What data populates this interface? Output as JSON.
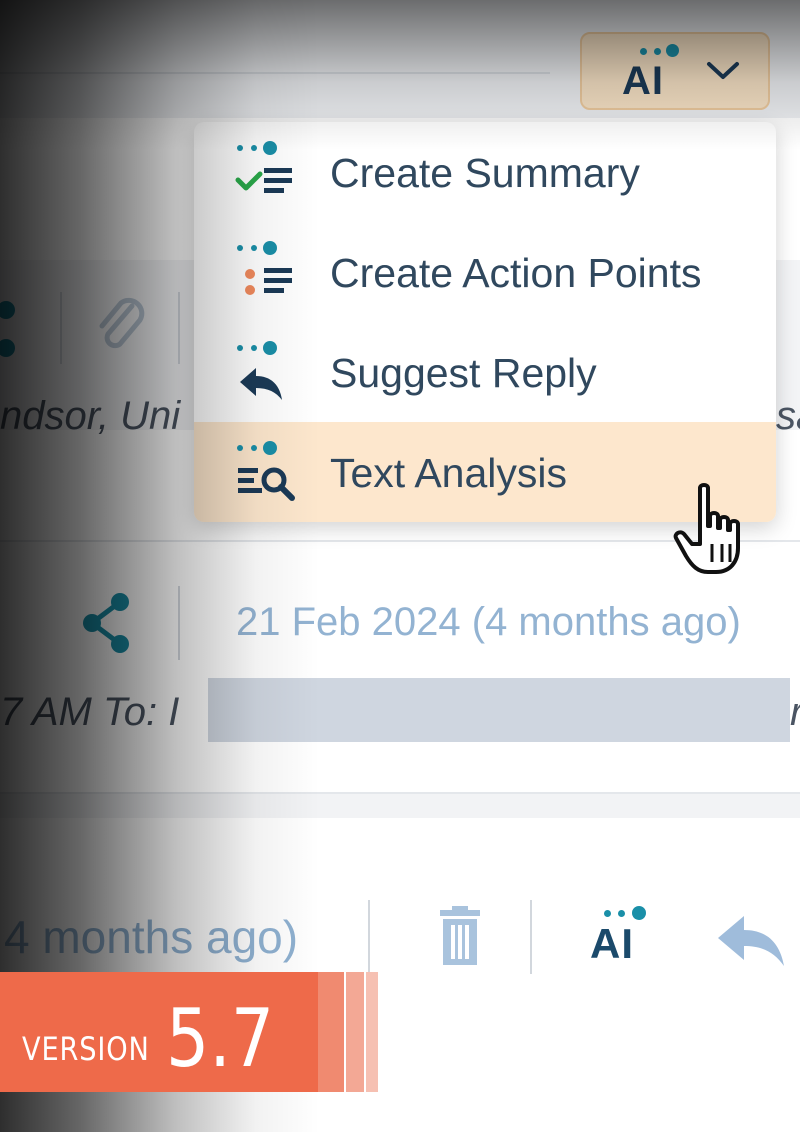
{
  "ai_toggle": {
    "label": "AI",
    "icon": "chevron-down-icon"
  },
  "menu": {
    "items": [
      {
        "label": "Create Summary",
        "icon": "summary-icon"
      },
      {
        "label": "Create Action Points",
        "icon": "action-points-icon"
      },
      {
        "label": "Suggest Reply",
        "icon": "reply-icon"
      },
      {
        "label": "Text Analysis",
        "icon": "text-analysis-icon",
        "hovered": true
      }
    ]
  },
  "email_1": {
    "location_fragment": "ndsor, Uni",
    "right_fragment": "sa"
  },
  "email_2": {
    "date": "21 Feb 2024 (4 months ago)",
    "to_fragment": "7 AM To: I",
    "right_fragment": "r"
  },
  "email_3": {
    "date_fragment": "4 months ago)",
    "ai_label": "AI"
  },
  "version": {
    "label": "VERSION",
    "number": "5.7"
  },
  "colors": {
    "accent_teal": "#1a8fa8",
    "dark_blue": "#1b3a57",
    "hover_bg": "#fde7cd",
    "banner": "#ee6a4a"
  }
}
